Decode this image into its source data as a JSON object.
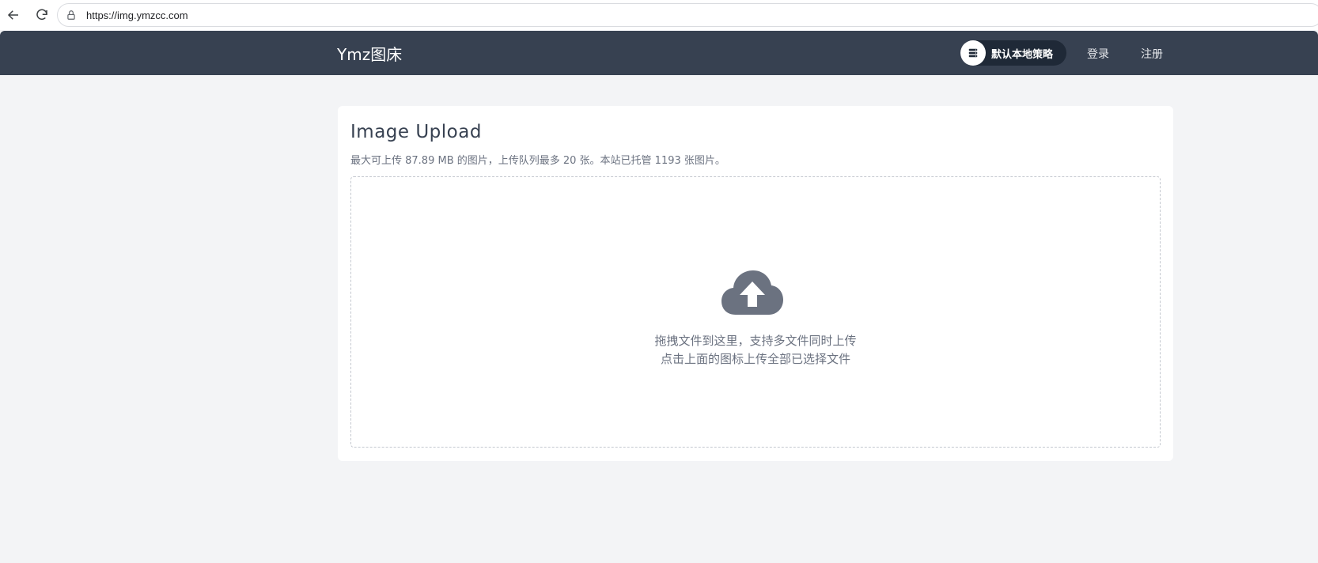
{
  "browser": {
    "url": "https://img.ymzcc.com",
    "back_icon": "arrow-left-icon",
    "reload_icon": "reload-icon",
    "lock_icon": "lock-icon"
  },
  "header": {
    "brand": "Ymz图床",
    "strategy_label": "默认本地策略",
    "strategy_icon": "server-icon",
    "login_label": "登录",
    "register_label": "注册",
    "bg_color": "#374151"
  },
  "upload": {
    "title": "Image Upload",
    "subtitle": "最大可上传 87.89 MB 的图片，上传队列最多 20 张。本站已托管 1193 张图片。",
    "upload_icon": "cloud-upload-icon",
    "hint_line1": "拖拽文件到这里，支持多文件同时上传",
    "hint_line2": "点击上面的图标上传全部已选择文件"
  }
}
